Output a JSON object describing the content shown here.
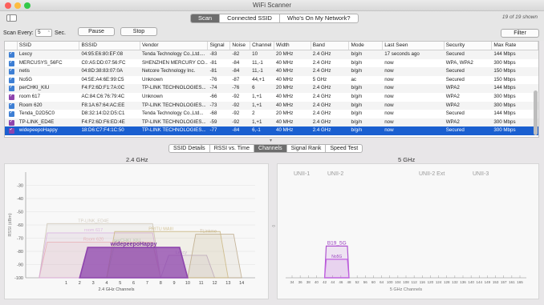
{
  "window": {
    "title": "WiFi Scanner"
  },
  "toolbar": {
    "tabs": [
      {
        "label": "Scan",
        "active": true
      },
      {
        "label": "Connected SSID",
        "active": false
      },
      {
        "label": "Who's On My Network?",
        "active": false
      }
    ],
    "shown_count": "19 of 19 shown",
    "scan_every_label": "Scan Every:",
    "scan_every_value": "5",
    "sec_label": "Sec.",
    "pause_label": "Pause",
    "stop_label": "Stop",
    "filter_label": "Filter"
  },
  "table": {
    "columns": [
      "",
      "SSID",
      "BSSID",
      "Vendor",
      "Signal",
      "Noise",
      "Channel",
      "Width",
      "Band",
      "Mode",
      "Last Seen",
      "Security",
      "Max Rate"
    ],
    "rows": [
      {
        "color": "#3e7fd4",
        "cells": [
          "Lexcy",
          "04:95:E6:80:EF:08",
          "Tenda Technology Co.,Ltd....",
          "-83",
          "-82",
          "10",
          "20 MHz",
          "2.4 GHz",
          "b/g/n",
          "17 seconds ago",
          "Secured",
          "144 Mbps"
        ]
      },
      {
        "color": "#3e7fd4",
        "cells": [
          "MERCUSYS_56FC",
          "C0:A5:DD:07:56:FC",
          "SHENZHEN MERCURY CO....",
          "-81",
          "-84",
          "11,-1",
          "40 MHz",
          "2.4 GHz",
          "b/g/n",
          "now",
          "WPA, WPA2",
          "300 Mbps"
        ]
      },
      {
        "color": "#3e7fd4",
        "cells": [
          "netis",
          "04:8D:38:83:07:0A",
          "Netcore Technology Inc.",
          "-81",
          "-84",
          "11,-1",
          "40 MHz",
          "2.4 GHz",
          "b/g/n",
          "now",
          "Secured",
          "150 Mbps"
        ]
      },
      {
        "color": "#3e7fd4",
        "cells": [
          "No5G",
          "04:5E:A4:6E:99:C5",
          "Unknown",
          "-76",
          "-87",
          "44,+1",
          "40 MHz",
          "5 GHz",
          "ac",
          "now",
          "Secured",
          "150 Mbps"
        ]
      },
      {
        "color": "#3e7fd4",
        "cells": [
          "perCHKI_KIU",
          "F4:F2:6D:F1:7A:0C",
          "TP-LINK TECHNOLOGIES...",
          "-74",
          "-76",
          "6",
          "20 MHz",
          "2.4 GHz",
          "b/g/n",
          "now",
          "WPA2",
          "144 Mbps"
        ]
      },
      {
        "color": "#8e44ad",
        "cells": [
          "room 617",
          "AC:84:C6:76:79:4C",
          "Unknown",
          "-66",
          "-92",
          "1,+1",
          "40 MHz",
          "2.4 GHz",
          "b/g/n",
          "now",
          "WPA2",
          "300 Mbps"
        ]
      },
      {
        "color": "#3e7fd4",
        "cells": [
          "Room 620",
          "F8:1A:67:64:AC:EE",
          "TP-LINK TECHNOLOGIES...",
          "-73",
          "-92",
          "1,+1",
          "40 MHz",
          "2.4 GHz",
          "b/g/n",
          "now",
          "WPA2",
          "300 Mbps"
        ]
      },
      {
        "color": "#3e7fd4",
        "cells": [
          "Tenda_D2D5C0",
          "D8:32:14:D2:D5:C1",
          "Tenda Technology Co.,Ltd...",
          "-68",
          "-92",
          "2",
          "20 MHz",
          "2.4 GHz",
          "b/g/n",
          "now",
          "Secured",
          "144 Mbps"
        ]
      },
      {
        "color": "#8e44ad",
        "cells": [
          "TP-LINK_ED4E",
          "F4:F2:6D:F6:ED:4E",
          "TP-LINK TECHNOLOGIES...",
          "-59",
          "-92",
          "1,+1",
          "40 MHz",
          "2.4 GHz",
          "b/g/n",
          "now",
          "WPA2",
          "300 Mbps"
        ]
      },
      {
        "color": "#8e44ad",
        "cells": [
          "widepeepoHappy",
          "18:D6:C7:F4:1C:50",
          "TP-LINK TECHNOLOGIES...",
          "-77",
          "-84",
          "6,-1",
          "40 MHz",
          "2.4 GHz",
          "b/g/n",
          "now",
          "Secured",
          "300 Mbps"
        ]
      }
    ],
    "selected_row": 9
  },
  "bottom_tabs": [
    {
      "label": "SSID Details",
      "active": false
    },
    {
      "label": "RSSI vs. Time",
      "active": false
    },
    {
      "label": "Channels",
      "active": true
    },
    {
      "label": "Signal Rank",
      "active": false
    },
    {
      "label": "Speed Test",
      "active": false
    }
  ],
  "chart_data": [
    {
      "type": "area",
      "title": "2.4 GHz",
      "xlabel": "2.4 GHz Channels",
      "ylabel": "RSSI (dBm)",
      "x_ticks": [
        "1",
        "2",
        "3",
        "4",
        "5",
        "6",
        "7",
        "8",
        "9",
        "10",
        "11",
        "12",
        "13",
        "14"
      ],
      "y_ticks": [
        "-30",
        "-40",
        "-50",
        "-60",
        "-70",
        "-80",
        "-90",
        "-100"
      ],
      "ylim": [
        -100,
        -20
      ],
      "series": [
        {
          "name": "widepeepoHappy",
          "x_range": [
            2,
            10
          ],
          "rssi": -77,
          "color": "#8e44ad"
        },
        {
          "name": "PRITU MAIII",
          "x_range": [
            4,
            13
          ],
          "rssi": -65,
          "color": "#c8b37a"
        },
        {
          "name": "TLinkme",
          "x_range": [
            10,
            14
          ],
          "rssi": -67,
          "color": "#b9a584"
        },
        {
          "name": "room 617",
          "x_range": [
            -1,
            8
          ],
          "rssi": -66,
          "color": "#d7a9de"
        },
        {
          "name": "Room 620",
          "x_range": [
            -1,
            8
          ],
          "rssi": -73,
          "color": "#e8a8a8"
        },
        {
          "name": "TP-LINK_ED4E",
          "x_range": [
            -1,
            8
          ],
          "rssi": -59,
          "color": "#c9c0b0"
        },
        {
          "name": "perCHKI_KIU",
          "x_range": [
            4,
            8
          ],
          "rssi": -74,
          "color": "#9ec8a0"
        },
        {
          "name": "Lexcy",
          "x_range": [
            8,
            12
          ],
          "rssi": -83,
          "color": "#b8a0c8"
        }
      ]
    },
    {
      "type": "area",
      "title": "5 GHz",
      "xlabel": "5 GHz Channels",
      "bands": [
        "UNII-1",
        "UNII-2",
        "UNII-2 Ext",
        "UNII-3"
      ],
      "x_ticks": [
        "34",
        "36",
        "38",
        "40",
        "42",
        "44",
        "46",
        "48",
        "52",
        "56",
        "60",
        "64",
        "100",
        "104",
        "108",
        "112",
        "116",
        "120",
        "124",
        "128",
        "132",
        "136",
        "140",
        "144",
        "149",
        "153",
        "157",
        "161",
        "165"
      ],
      "series": [
        {
          "name": "B19_5G",
          "x_range": [
            42,
            48
          ],
          "rssi": -76,
          "color": "#b055d0"
        },
        {
          "name": "No5G",
          "x_range": [
            42,
            48
          ],
          "rssi": -86,
          "color": "#c060e0"
        }
      ]
    }
  ]
}
